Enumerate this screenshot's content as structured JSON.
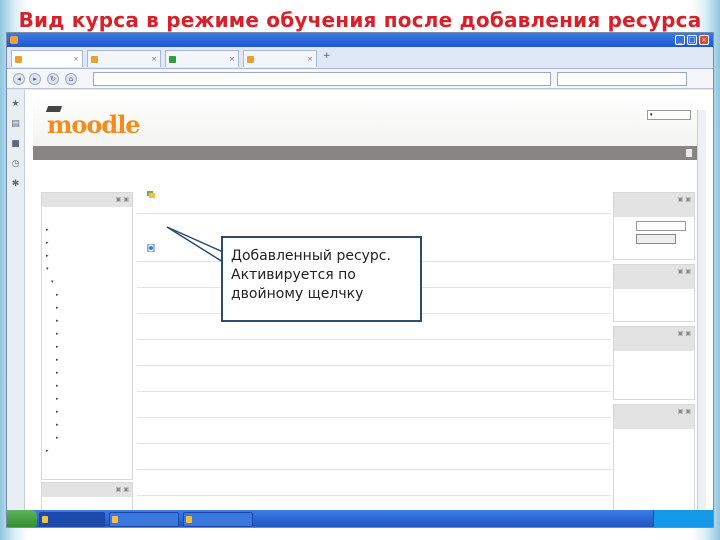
{
  "slide": {
    "title": "Вид курса в режиме обучения после добавления ресурса",
    "title_color": "#d8202a"
  },
  "callout": {
    "line1": "Добавленный ресурс.",
    "line2": "Активируется по",
    "line3": "двойному щелчку"
  },
  "site": {
    "logo": "moodle"
  }
}
